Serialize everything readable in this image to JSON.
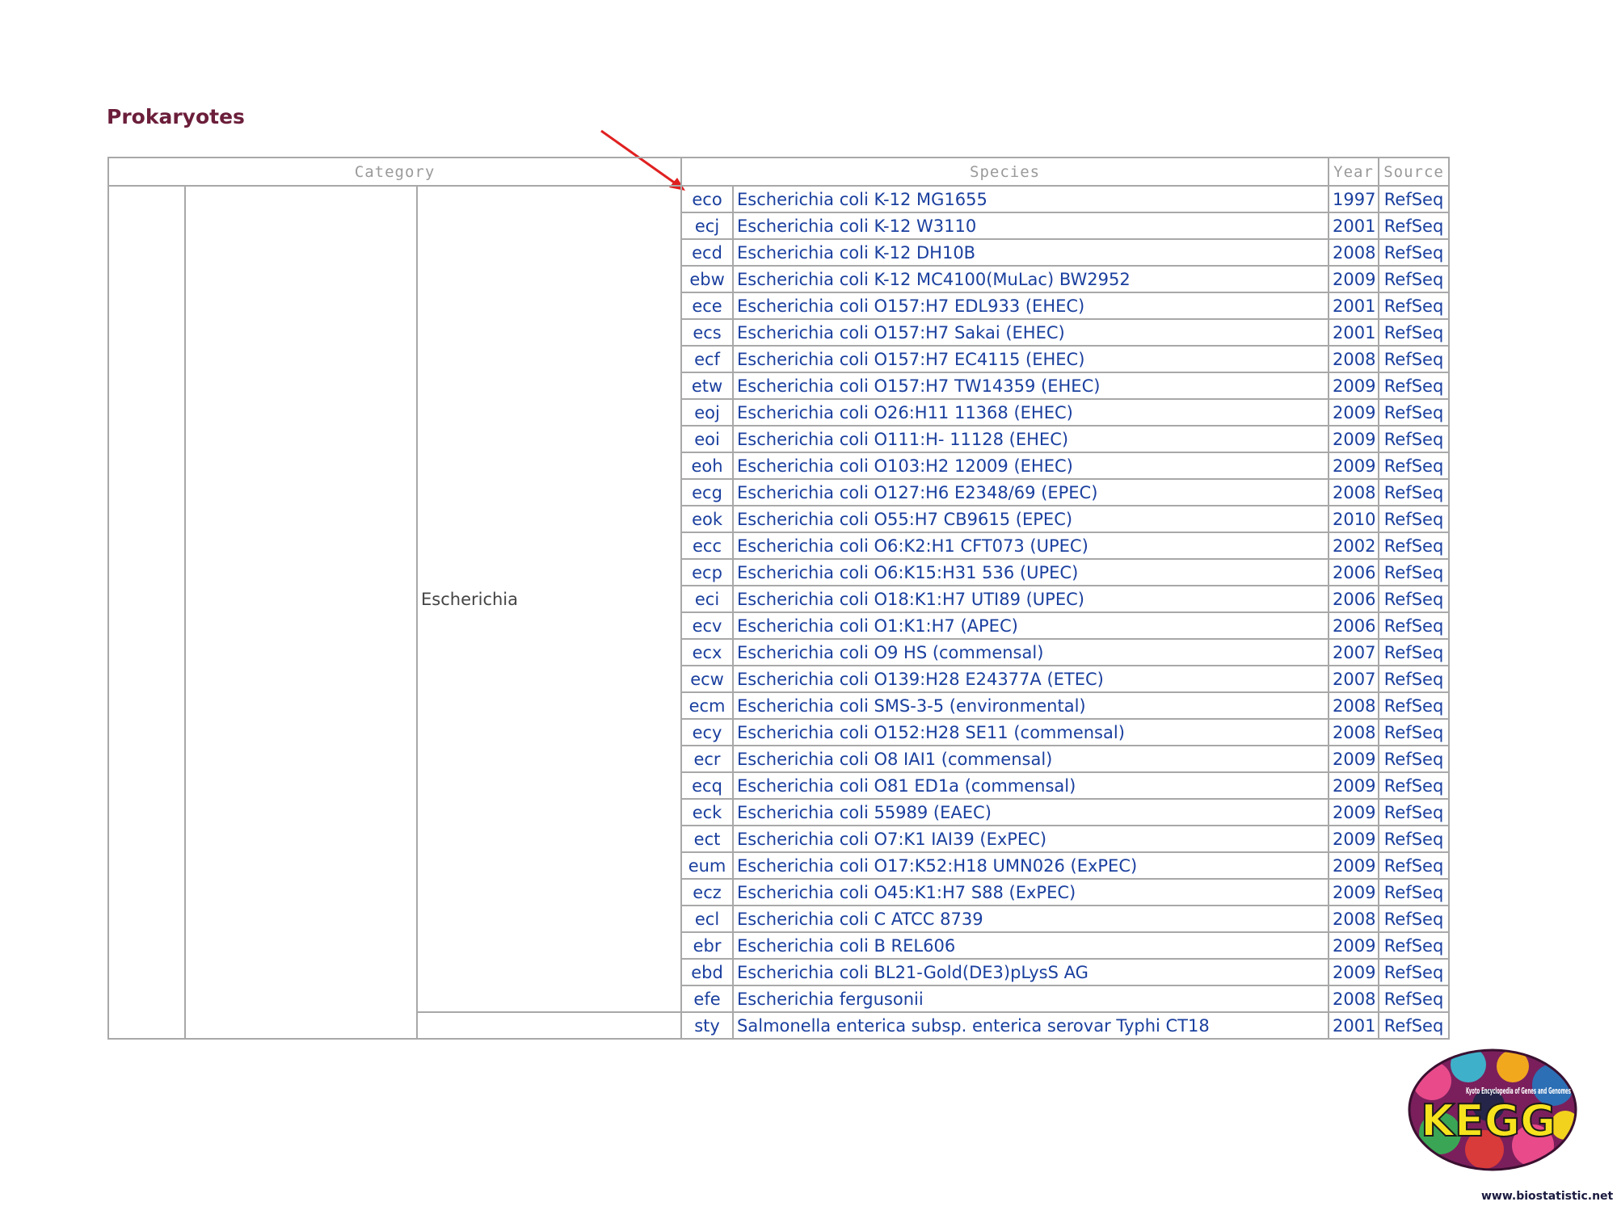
{
  "page": {
    "title": "Prokaryotes"
  },
  "table": {
    "headers": {
      "category": "Category",
      "species": "Species",
      "year": "Year",
      "source": "Source"
    },
    "groups": [
      {
        "genus": "Escherichia",
        "rows": [
          {
            "org": "eco",
            "species": "Escherichia coli K-12 MG1655",
            "year": "1997",
            "source": "RefSeq"
          },
          {
            "org": "ecj",
            "species": "Escherichia coli K-12 W3110",
            "year": "2001",
            "source": "RefSeq"
          },
          {
            "org": "ecd",
            "species": "Escherichia coli K-12 DH10B",
            "year": "2008",
            "source": "RefSeq"
          },
          {
            "org": "ebw",
            "species": "Escherichia coli K-12 MC4100(MuLac) BW2952",
            "year": "2009",
            "source": "RefSeq"
          },
          {
            "org": "ece",
            "species": "Escherichia coli O157:H7 EDL933 (EHEC)",
            "year": "2001",
            "source": "RefSeq"
          },
          {
            "org": "ecs",
            "species": "Escherichia coli O157:H7 Sakai (EHEC)",
            "year": "2001",
            "source": "RefSeq"
          },
          {
            "org": "ecf",
            "species": "Escherichia coli O157:H7 EC4115 (EHEC)",
            "year": "2008",
            "source": "RefSeq"
          },
          {
            "org": "etw",
            "species": "Escherichia coli O157:H7 TW14359 (EHEC)",
            "year": "2009",
            "source": "RefSeq"
          },
          {
            "org": "eoj",
            "species": "Escherichia coli O26:H11 11368 (EHEC)",
            "year": "2009",
            "source": "RefSeq"
          },
          {
            "org": "eoi",
            "species": "Escherichia coli O111:H- 11128 (EHEC)",
            "year": "2009",
            "source": "RefSeq"
          },
          {
            "org": "eoh",
            "species": "Escherichia coli O103:H2 12009 (EHEC)",
            "year": "2009",
            "source": "RefSeq"
          },
          {
            "org": "ecg",
            "species": "Escherichia coli O127:H6 E2348/69 (EPEC)",
            "year": "2008",
            "source": "RefSeq"
          },
          {
            "org": "eok",
            "species": "Escherichia coli O55:H7 CB9615 (EPEC)",
            "year": "2010",
            "source": "RefSeq"
          },
          {
            "org": "ecc",
            "species": "Escherichia coli O6:K2:H1 CFT073 (UPEC)",
            "year": "2002",
            "source": "RefSeq"
          },
          {
            "org": "ecp",
            "species": "Escherichia coli O6:K15:H31 536 (UPEC)",
            "year": "2006",
            "source": "RefSeq"
          },
          {
            "org": "eci",
            "species": "Escherichia coli O18:K1:H7 UTI89 (UPEC)",
            "year": "2006",
            "source": "RefSeq"
          },
          {
            "org": "ecv",
            "species": "Escherichia coli O1:K1:H7 (APEC)",
            "year": "2006",
            "source": "RefSeq"
          },
          {
            "org": "ecx",
            "species": "Escherichia coli O9 HS (commensal)",
            "year": "2007",
            "source": "RefSeq"
          },
          {
            "org": "ecw",
            "species": "Escherichia coli O139:H28 E24377A (ETEC)",
            "year": "2007",
            "source": "RefSeq"
          },
          {
            "org": "ecm",
            "species": "Escherichia coli SMS-3-5 (environmental)",
            "year": "2008",
            "source": "RefSeq"
          },
          {
            "org": "ecy",
            "species": "Escherichia coli O152:H28 SE11 (commensal)",
            "year": "2008",
            "source": "RefSeq"
          },
          {
            "org": "ecr",
            "species": "Escherichia coli O8 IAI1 (commensal)",
            "year": "2009",
            "source": "RefSeq"
          },
          {
            "org": "ecq",
            "species": "Escherichia coli O81 ED1a (commensal)",
            "year": "2009",
            "source": "RefSeq"
          },
          {
            "org": "eck",
            "species": "Escherichia coli 55989 (EAEC)",
            "year": "2009",
            "source": "RefSeq"
          },
          {
            "org": "ect",
            "species": "Escherichia coli O7:K1 IAI39 (ExPEC)",
            "year": "2009",
            "source": "RefSeq"
          },
          {
            "org": "eum",
            "species": "Escherichia coli O17:K52:H18 UMN026 (ExPEC)",
            "year": "2009",
            "source": "RefSeq"
          },
          {
            "org": "ecz",
            "species": "Escherichia coli O45:K1:H7 S88 (ExPEC)",
            "year": "2009",
            "source": "RefSeq"
          },
          {
            "org": "ecl",
            "species": "Escherichia coli C ATCC 8739",
            "year": "2008",
            "source": "RefSeq"
          },
          {
            "org": "ebr",
            "species": "Escherichia coli B REL606",
            "year": "2009",
            "source": "RefSeq"
          },
          {
            "org": "ebd",
            "species": "Escherichia coli BL21-Gold(DE3)pLysS AG",
            "year": "2009",
            "source": "RefSeq"
          },
          {
            "org": "efe",
            "species": "Escherichia fergusonii",
            "year": "2008",
            "source": "RefSeq"
          }
        ]
      },
      {
        "genus": "",
        "rows": [
          {
            "org": "sty",
            "species": "Salmonella enterica subsp. enterica serovar Typhi CT18",
            "year": "2001",
            "source": "RefSeq"
          }
        ]
      }
    ]
  },
  "logo": {
    "brand": "KEGG",
    "tagline": "Kyoto Encyclopedia of Genes and Genomes"
  },
  "footer": {
    "url": "www.biostatistic.net"
  },
  "colors": {
    "title": "#6b1e3a",
    "link": "#1a3f9e",
    "border": "#a8a8a8",
    "arrow": "#e02020"
  }
}
